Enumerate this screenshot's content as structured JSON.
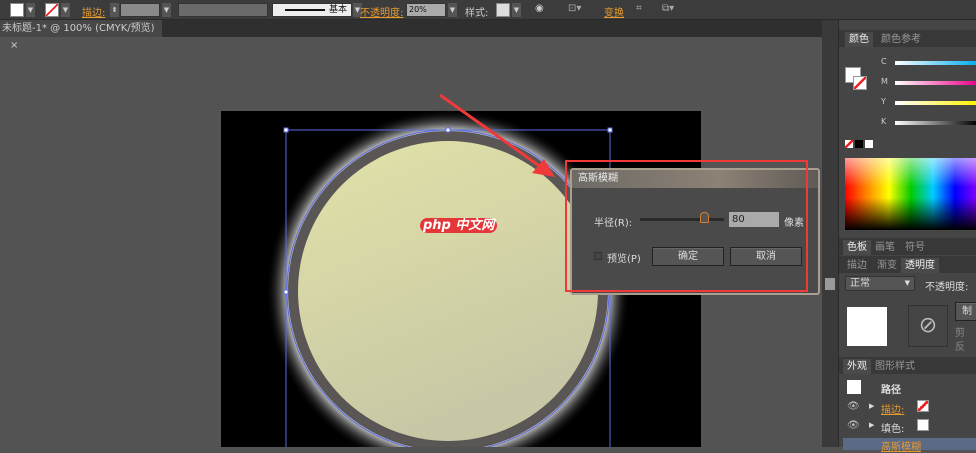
{
  "toolbar": {
    "stroke_label": "描边:",
    "stroke_style": "基本",
    "opacity_label": "不透明度:",
    "opacity_value": "20%",
    "style_label": "样式:",
    "transform_label": "变换"
  },
  "document": {
    "tab_title": "未标题-1* @ 100% (CMYK/预览)",
    "close": "×"
  },
  "watermark": {
    "text": "php 中文网"
  },
  "dialog": {
    "title": "高斯模糊",
    "radius_label": "半径(R):",
    "radius_value": "80",
    "unit": "像素",
    "radius_fraction": 0.8,
    "preview_label": "预览(P)",
    "ok": "确定",
    "cancel": "取消"
  },
  "color_panel": {
    "tabs": [
      "颜色",
      "颜色参考"
    ],
    "channels": [
      "C",
      "M",
      "Y",
      "K"
    ]
  },
  "swatch_tabs": [
    "色板",
    "画笔",
    "符号"
  ],
  "transparency": {
    "tabs": [
      "描边",
      "渐变",
      "透明度"
    ],
    "blend_mode": "正常",
    "opacity_label": "不透明度:",
    "make_mask": "制",
    "clip": "剪",
    "invert": "反"
  },
  "appearance": {
    "tabs": [
      "外观",
      "图形样式"
    ],
    "path": "路径",
    "stroke": "描边:",
    "fill": "填色:",
    "effect": "高斯模糊"
  },
  "colors": {
    "accent": "#e79a2d",
    "highlight": "#f03a3a"
  }
}
